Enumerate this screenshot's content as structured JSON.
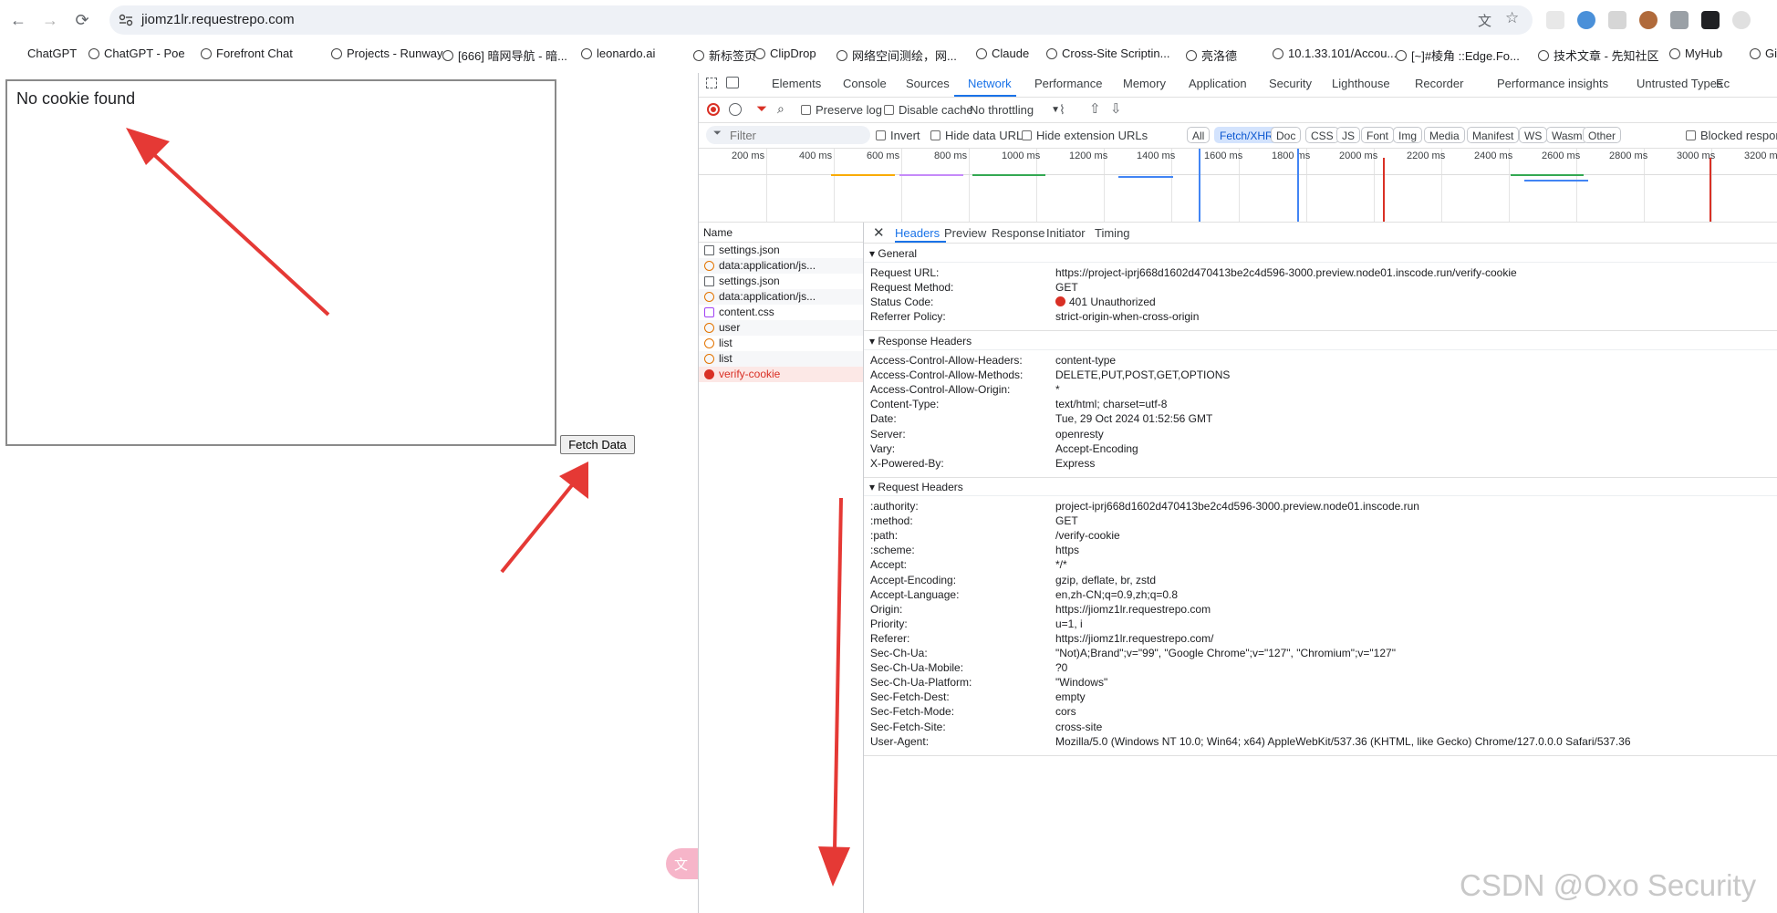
{
  "browser": {
    "url": "jiomz1lr.requestrepo.com",
    "bookmarks": [
      {
        "label": "ChatGPT"
      },
      {
        "label": "ChatGPT - Poe"
      },
      {
        "label": "Forefront Chat"
      },
      {
        "label": "Projects - Runway"
      },
      {
        "label": "[666] 暗网导航 - 暗..."
      },
      {
        "label": "leonardo.ai"
      },
      {
        "label": "新标签页"
      },
      {
        "label": "ClipDrop"
      },
      {
        "label": "网络空间测绘，网..."
      },
      {
        "label": "Claude"
      },
      {
        "label": "Cross-Site Scriptin..."
      },
      {
        "label": "亮洛德"
      },
      {
        "label": "10.1.33.101/Accou..."
      },
      {
        "label": "[~]#棱角 ::Edge.Fo..."
      },
      {
        "label": "技术文章 - 先知社区"
      },
      {
        "label": "MyHub"
      },
      {
        "label": "Git"
      }
    ]
  },
  "page": {
    "cookie_message": "No cookie found",
    "fetch_button": "Fetch Data"
  },
  "devtools": {
    "tabs": [
      "Elements",
      "Console",
      "Sources",
      "Network",
      "Performance",
      "Memory",
      "Application",
      "Security",
      "Lighthouse",
      "Recorder",
      "Performance insights",
      "Untrusted Types",
      "Ec"
    ],
    "active_tab": "Network",
    "toolbar": {
      "preserve_log": "Preserve log",
      "disable_cache": "Disable cache",
      "throttling": "No throttling"
    },
    "filter": {
      "placeholder": "Filter",
      "invert": "Invert",
      "hide_data_urls": "Hide data URLs",
      "hide_extension_urls": "Hide extension URLs",
      "type_pills": [
        "All",
        "Fetch/XHR",
        "Doc",
        "CSS",
        "JS",
        "Font",
        "Img",
        "Media",
        "Manifest",
        "WS",
        "Wasm",
        "Other"
      ],
      "active_pill": "Fetch/XHR",
      "blocked": "Blocked respon"
    },
    "timeline_ticks": [
      "200 ms",
      "400 ms",
      "600 ms",
      "800 ms",
      "1000 ms",
      "1200 ms",
      "1400 ms",
      "1600 ms",
      "1800 ms",
      "2000 ms",
      "2200 ms",
      "2400 ms",
      "2600 ms",
      "2800 ms",
      "3000 ms",
      "3200 m"
    ],
    "request_list_header": "Name",
    "requests": [
      {
        "name": "settings.json",
        "type": "doc"
      },
      {
        "name": "data:application/js...",
        "type": "xhr"
      },
      {
        "name": "settings.json",
        "type": "doc"
      },
      {
        "name": "data:application/js...",
        "type": "xhr"
      },
      {
        "name": "content.css",
        "type": "css"
      },
      {
        "name": "user",
        "type": "xhr"
      },
      {
        "name": "list",
        "type": "xhr"
      },
      {
        "name": "list",
        "type": "xhr"
      },
      {
        "name": "verify-cookie",
        "type": "error"
      }
    ],
    "detail_tabs": [
      "Headers",
      "Preview",
      "Response",
      "Initiator",
      "Timing"
    ],
    "active_detail_tab": "Headers",
    "general": {
      "title": "General",
      "rows": [
        {
          "k": "Request URL:",
          "v": "https://project-iprj668d1602d470413be2c4d596-3000.preview.node01.inscode.run/verify-cookie"
        },
        {
          "k": "Request Method:",
          "v": "GET"
        },
        {
          "k": "Status Code:",
          "v": "401 Unauthorized"
        },
        {
          "k": "Referrer Policy:",
          "v": "strict-origin-when-cross-origin"
        }
      ]
    },
    "response_headers": {
      "title": "Response Headers",
      "rows": [
        {
          "k": "Access-Control-Allow-Headers:",
          "v": "content-type"
        },
        {
          "k": "Access-Control-Allow-Methods:",
          "v": "DELETE,PUT,POST,GET,OPTIONS"
        },
        {
          "k": "Access-Control-Allow-Origin:",
          "v": "*"
        },
        {
          "k": "Content-Type:",
          "v": "text/html; charset=utf-8"
        },
        {
          "k": "Date:",
          "v": "Tue, 29 Oct 2024 01:52:56 GMT"
        },
        {
          "k": "Server:",
          "v": "openresty"
        },
        {
          "k": "Vary:",
          "v": "Accept-Encoding"
        },
        {
          "k": "X-Powered-By:",
          "v": "Express"
        }
      ]
    },
    "request_headers": {
      "title": "Request Headers",
      "rows": [
        {
          "k": ":authority:",
          "v": "project-iprj668d1602d470413be2c4d596-3000.preview.node01.inscode.run"
        },
        {
          "k": ":method:",
          "v": "GET"
        },
        {
          "k": ":path:",
          "v": "/verify-cookie"
        },
        {
          "k": ":scheme:",
          "v": "https"
        },
        {
          "k": "Accept:",
          "v": "*/*"
        },
        {
          "k": "Accept-Encoding:",
          "v": "gzip, deflate, br, zstd"
        },
        {
          "k": "Accept-Language:",
          "v": "en,zh-CN;q=0.9,zh;q=0.8"
        },
        {
          "k": "Origin:",
          "v": "https://jiomz1lr.requestrepo.com"
        },
        {
          "k": "Priority:",
          "v": "u=1, i"
        },
        {
          "k": "Referer:",
          "v": "https://jiomz1lr.requestrepo.com/"
        },
        {
          "k": "Sec-Ch-Ua:",
          "v": "\"Not)A;Brand\";v=\"99\", \"Google Chrome\";v=\"127\", \"Chromium\";v=\"127\""
        },
        {
          "k": "Sec-Ch-Ua-Mobile:",
          "v": "?0"
        },
        {
          "k": "Sec-Ch-Ua-Platform:",
          "v": "\"Windows\""
        },
        {
          "k": "Sec-Fetch-Dest:",
          "v": "empty"
        },
        {
          "k": "Sec-Fetch-Mode:",
          "v": "cors"
        },
        {
          "k": "Sec-Fetch-Site:",
          "v": "cross-site"
        },
        {
          "k": "User-Agent:",
          "v": "Mozilla/5.0 (Windows NT 10.0; Win64; x64) AppleWebKit/537.36 (KHTML, like Gecko) Chrome/127.0.0.0 Safari/537.36"
        }
      ]
    }
  },
  "watermark": "CSDN @Oxo Security",
  "colors": {
    "accent": "#1a73e8",
    "error": "#d93025",
    "arrow": "#e53935"
  }
}
